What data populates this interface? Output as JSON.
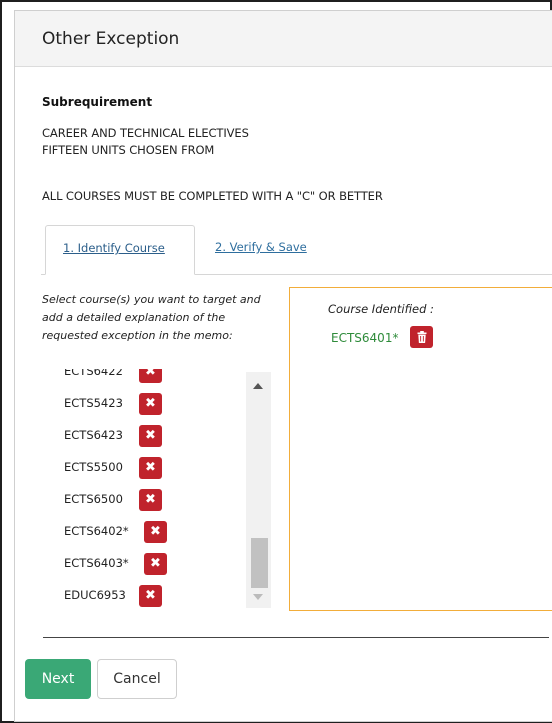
{
  "modal": {
    "title": "Other Exception"
  },
  "subrequirement": {
    "heading": "Subrequirement",
    "lines": [
      "CAREER AND TECHNICAL ELECTIVES",
      "FIFTEEN UNITS CHOSEN FROM",
      "ALL COURSES MUST BE COMPLETED WITH A \"C\" OR BETTER"
    ]
  },
  "tabs": [
    {
      "label": "1. Identify Course",
      "active": true
    },
    {
      "label": "2. Verify & Save",
      "active": false
    }
  ],
  "instructions": "Select course(s) you want to target and add a detailed explanation of the requested exception in the memo:",
  "course_list": {
    "remove_glyph": "✖",
    "items": [
      {
        "code": "ECTS6422"
      },
      {
        "code": "ECTS5423"
      },
      {
        "code": "ECTS6423"
      },
      {
        "code": "ECTS5500"
      },
      {
        "code": "ECTS6500"
      },
      {
        "code": "ECTS6402*"
      },
      {
        "code": "ECTS6403*"
      },
      {
        "code": "EDUC6953"
      }
    ]
  },
  "identified": {
    "title": "Course Identified :",
    "courses": [
      {
        "code": "ECTS6401*"
      }
    ]
  },
  "footer": {
    "next_label": "Next",
    "cancel_label": "Cancel"
  },
  "colors": {
    "next_button": "#3aa876",
    "remove_button": "#c0232c",
    "identified_border": "#f2ad3a",
    "identified_text": "#2e8b3a",
    "tab_link": "#2e6e9e"
  },
  "icons": {
    "remove": "close-icon",
    "trash": "trash-icon",
    "scroll_up": "chevron-up-icon",
    "scroll_down": "chevron-down-icon"
  }
}
